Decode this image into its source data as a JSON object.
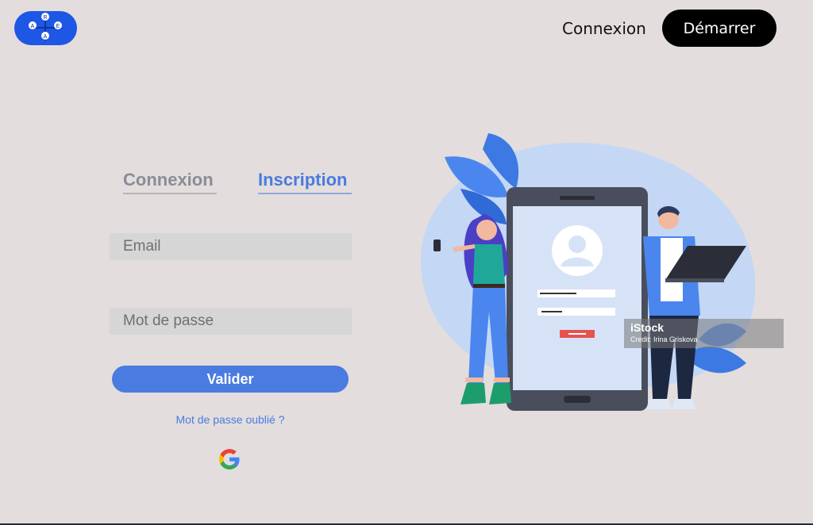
{
  "header": {
    "logo_letters": [
      "R",
      "A",
      "E",
      "A"
    ],
    "nav_login": "Connexion",
    "nav_start": "Démarrer"
  },
  "auth": {
    "tabs": [
      {
        "label": "Connexion",
        "active": false
      },
      {
        "label": "Inscription",
        "active": true
      }
    ],
    "email_placeholder": "Email",
    "password_placeholder": "Mot de passe",
    "submit_label": "Valider",
    "forgot_link": "Mot de passe oublié ?",
    "social_icon": "google-icon"
  },
  "illustration": {
    "watermark_brand": "iStock",
    "watermark_credit": "Credit: Irina Griskova"
  },
  "colors": {
    "background": "#e3dddd",
    "accent": "#4a7be0",
    "logo_blue": "#1e56e6",
    "cta_dark": "#000000"
  }
}
